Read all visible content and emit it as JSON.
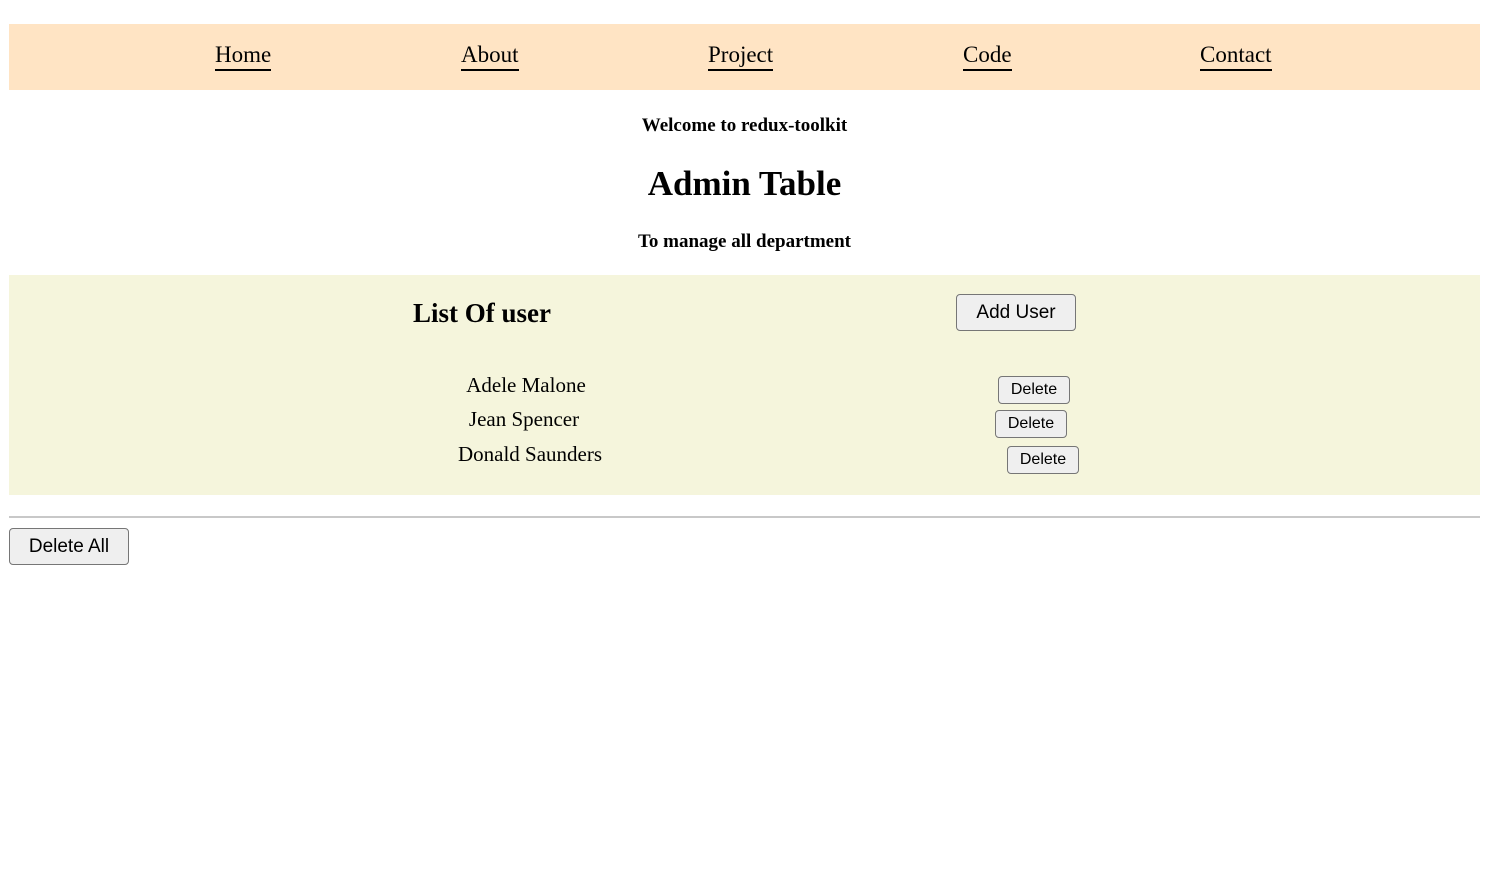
{
  "nav": {
    "items": [
      {
        "label": "Home"
      },
      {
        "label": "About"
      },
      {
        "label": "Project"
      },
      {
        "label": "Code"
      },
      {
        "label": "Contact"
      }
    ]
  },
  "header": {
    "welcome": "Welcome to redux-toolkit",
    "title": "Admin Table",
    "subtitle": "To manage all department"
  },
  "panel": {
    "heading": "List Of user",
    "add_button": "Add User",
    "delete_label": "Delete",
    "users": [
      {
        "name": "Adele Malone"
      },
      {
        "name": "Jean Spencer"
      },
      {
        "name": "Donald Saunders"
      }
    ]
  },
  "footer": {
    "delete_all_button": "Delete All"
  },
  "colors": {
    "navbar_bg": "#ffe4c4",
    "panel_bg": "#f5f5dc"
  }
}
